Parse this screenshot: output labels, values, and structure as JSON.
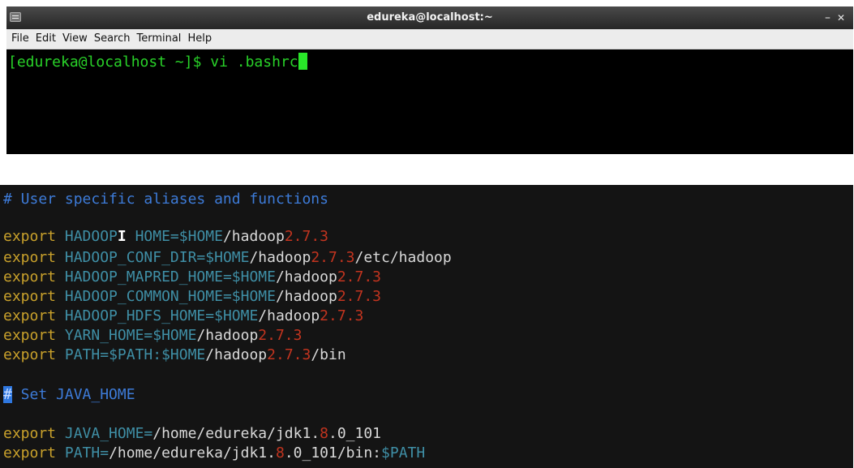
{
  "window": {
    "title": "edureka@localhost:~",
    "minimize": "–",
    "close": "✕"
  },
  "menu": [
    "File",
    "Edit",
    "View",
    "Search",
    "Terminal",
    "Help"
  ],
  "terminal": {
    "prompt": "[edureka@localhost ~]$ ",
    "command": "vi .bashrc"
  },
  "editor": {
    "comment1": "# User specific aliases and functions",
    "hadoop_version": "2.7.3",
    "lines": [
      {
        "kw": "export",
        "var": "HADOOP",
        "var2": " HOME=",
        "ref": "$HOME",
        "path": "/hadoop",
        "suffix": ""
      },
      {
        "kw": "export",
        "var": "HADOOP_CONF_DIR=",
        "ref": "$HOME",
        "path": "/hadoop",
        "suffix": "/etc/hadoop"
      },
      {
        "kw": "export",
        "var": "HADOOP_MAPRED_HOME=",
        "ref": "$HOME",
        "path": "/hadoop",
        "suffix": ""
      },
      {
        "kw": "export",
        "var": "HADOOP_COMMON_HOME=",
        "ref": "$HOME",
        "path": "/hadoop",
        "suffix": ""
      },
      {
        "kw": "export",
        "var": "HADOOP_HDFS_HOME=",
        "ref": "$HOME",
        "path": "/hadoop",
        "suffix": ""
      },
      {
        "kw": "export",
        "var": "YARN_HOME=",
        "ref": "$HOME",
        "path": "/hadoop",
        "suffix": ""
      },
      {
        "kw": "export",
        "var": "PATH=",
        "ref": "$PATH:$HOME",
        "path": "/hadoop",
        "suffix": "/bin"
      }
    ],
    "comment2_hash": "#",
    "comment2_text": " Set JAVA_HOME",
    "java_line1": {
      "kw": "export",
      "var": "JAVA_HOME=",
      "a": "/home/edureka/jdk1.",
      "b": "8",
      "c": ".0_101",
      "d": ""
    },
    "java_line2": {
      "kw": "export",
      "var": "PATH=",
      "a": "/home/edureka/jdk1.",
      "b": "8",
      "c": ".0_101/bin:",
      "d": "$PATH"
    }
  },
  "colors": {
    "keyword": "#c9a12b",
    "variable": "#3f8fa6",
    "version": "#c2341f",
    "comment": "#3d7bd8",
    "prompt": "#29d229"
  }
}
